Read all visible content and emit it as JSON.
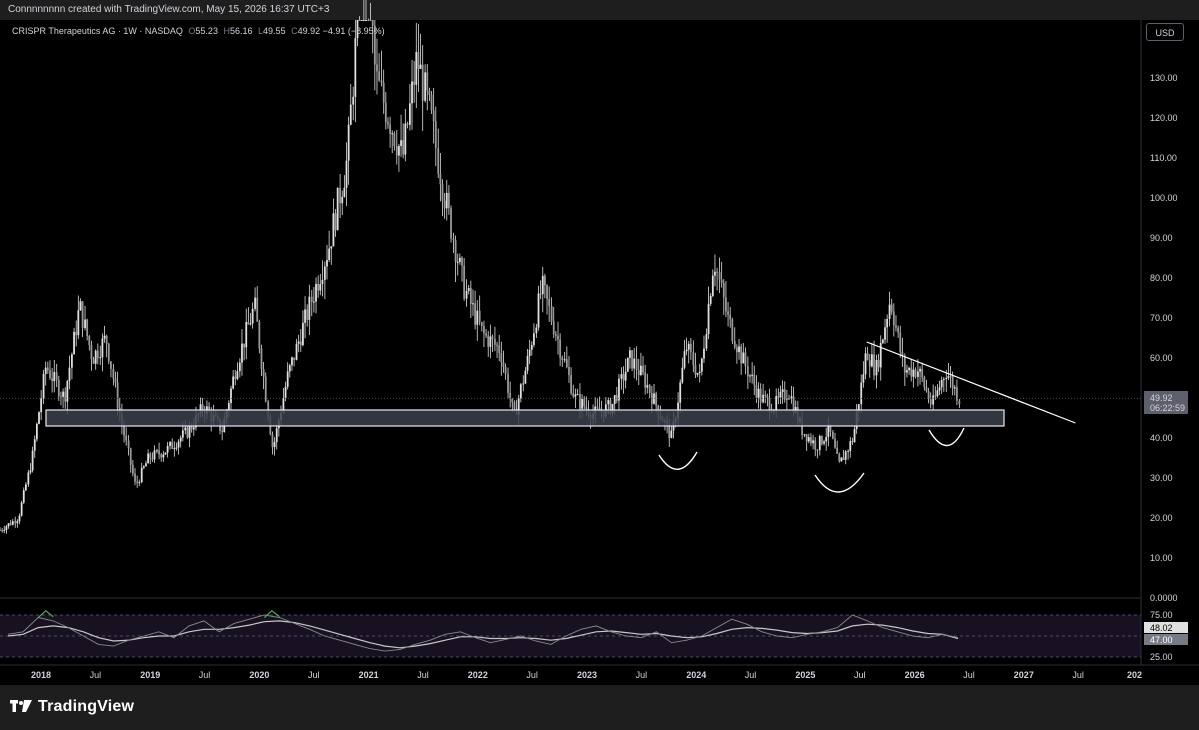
{
  "header": {
    "credit": "Connnnnnnn created with TradingView.com, May 15, 2026 16:37 UTC+3"
  },
  "legend": {
    "symbol": "CRISPR Therapeutics AG · 1W · NASDAQ",
    "open_label": "O",
    "open": "55.23",
    "high_label": "H",
    "high": "56.16",
    "low_label": "L",
    "low": "49.55",
    "close_label": "C",
    "close": "49.92",
    "change": "−4.91 (−8.95%)"
  },
  "currency_button": "USD",
  "price_axis": {
    "ticks": [
      "130.00",
      "120.00",
      "110.00",
      "100.00",
      "90.00",
      "80.00",
      "70.00",
      "60.00",
      "40.00",
      "30.00",
      "20.00",
      "10.00",
      "0.0000"
    ],
    "last_price": "49.92",
    "countdown": "06:22:59"
  },
  "rsi_axis": {
    "ticks": [
      "75.00",
      "25.00"
    ],
    "rsi_value": "48.02",
    "ma_value": "47.00"
  },
  "time_axis": {
    "labels": [
      "2018",
      "Jul",
      "2019",
      "Jul",
      "2020",
      "Jul",
      "2021",
      "Jul",
      "2022",
      "Jul",
      "2023",
      "Jul",
      "2024",
      "Jul",
      "2025",
      "Jul",
      "2026",
      "Jul",
      "2027",
      "Jul",
      "202"
    ]
  },
  "footer": {
    "brand": "TradingView"
  },
  "colors": {
    "background": "#000000",
    "candles": "#e0e0e0",
    "annotation": "#ffffff",
    "zone_fill": "#3b3f4a",
    "rsi_band": "#2a1f3d",
    "rsi_line": "#b0b0b0",
    "rsi_overbought": "#4caf50",
    "last_price_bg": "#5d606b"
  },
  "chart_data": [
    {
      "type": "candlestick",
      "title": "CRISPR Therapeutics AG · 1W · NASDAQ",
      "ylim": [
        0,
        140
      ],
      "x_range": [
        "2017-10",
        "2028-01"
      ],
      "points": [
        [
          "2017-10-01",
          17
        ],
        [
          "2017-12-01",
          20
        ],
        [
          "2018-01-15",
          35
        ],
        [
          "2018-03-01",
          58
        ],
        [
          "2018-05-01",
          50
        ],
        [
          "2018-06-20",
          73
        ],
        [
          "2018-08-01",
          60
        ],
        [
          "2018-09-15",
          65
        ],
        [
          "2018-11-01",
          45
        ],
        [
          "2018-12-20",
          28
        ],
        [
          "2019-02-01",
          35
        ],
        [
          "2019-04-01",
          37
        ],
        [
          "2019-06-15",
          42
        ],
        [
          "2019-08-01",
          48
        ],
        [
          "2019-10-01",
          42
        ],
        [
          "2019-11-15",
          58
        ],
        [
          "2020-01-15",
          73
        ],
        [
          "2020-03-15",
          37
        ],
        [
          "2020-05-01",
          55
        ],
        [
          "2020-07-01",
          70
        ],
        [
          "2020-09-15",
          88
        ],
        [
          "2020-11-15",
          110
        ],
        [
          "2021-01-10",
          170
        ],
        [
          "2021-02-15",
          130
        ],
        [
          "2021-04-01",
          120
        ],
        [
          "2021-05-15",
          110
        ],
        [
          "2021-07-01",
          135
        ],
        [
          "2021-08-15",
          120
        ],
        [
          "2021-10-01",
          100
        ],
        [
          "2021-12-01",
          78
        ],
        [
          "2022-02-01",
          66
        ],
        [
          "2022-04-01",
          62
        ],
        [
          "2022-05-15",
          45
        ],
        [
          "2022-07-01",
          60
        ],
        [
          "2022-08-15",
          78
        ],
        [
          "2022-10-01",
          66
        ],
        [
          "2022-12-01",
          50
        ],
        [
          "2023-02-01",
          46
        ],
        [
          "2023-04-01",
          48
        ],
        [
          "2023-06-01",
          60
        ],
        [
          "2023-07-15",
          55
        ],
        [
          "2023-09-01",
          47
        ],
        [
          "2023-10-15",
          40
        ],
        [
          "2023-12-01",
          63
        ],
        [
          "2024-01-15",
          55
        ],
        [
          "2024-03-01",
          85
        ],
        [
          "2024-04-15",
          70
        ],
        [
          "2024-06-01",
          60
        ],
        [
          "2024-08-01",
          50
        ],
        [
          "2024-09-15",
          48
        ],
        [
          "2024-11-01",
          52
        ],
        [
          "2024-12-15",
          42
        ],
        [
          "2025-02-01",
          38
        ],
        [
          "2025-03-15",
          42
        ],
        [
          "2025-04-15",
          33
        ],
        [
          "2025-06-01",
          40
        ],
        [
          "2025-07-15",
          62
        ],
        [
          "2025-08-15",
          57
        ],
        [
          "2025-10-01",
          75
        ],
        [
          "2025-11-15",
          57
        ],
        [
          "2026-01-01",
          57
        ],
        [
          "2026-02-15",
          48
        ],
        [
          "2026-04-01",
          57
        ],
        [
          "2026-05-15",
          49.92
        ]
      ],
      "close": 49.92,
      "annotations": {
        "support_zone": [
          43,
          47
        ],
        "trendline": [
          [
            "2025-07-15",
            64
          ],
          [
            "2026-11-15",
            43
          ]
        ],
        "arcs": [
          "2023-10",
          "2025-04",
          "2026-03"
        ]
      }
    },
    {
      "type": "line",
      "title": "RSI",
      "ylim": [
        25,
        75
      ],
      "series": [
        {
          "values": [
            52,
            55,
            72,
            68,
            60,
            50,
            40,
            38,
            45,
            50,
            55,
            48,
            62,
            68,
            55,
            65,
            70,
            75,
            72,
            65,
            58,
            50,
            45,
            40,
            35,
            32,
            34,
            40,
            45,
            52,
            55,
            48,
            42,
            46,
            50,
            44,
            40,
            50,
            58,
            62,
            55,
            50,
            48,
            55,
            42,
            45,
            50,
            60,
            70,
            64,
            55,
            50,
            48,
            52,
            55,
            60,
            75,
            68,
            60,
            55,
            50,
            48,
            52,
            48.02
          ]
        },
        {
          "values": [
            50,
            52,
            60,
            62,
            60,
            55,
            48,
            44,
            45,
            48,
            50,
            50,
            55,
            58,
            58,
            60,
            63,
            67,
            68,
            66,
            62,
            57,
            52,
            47,
            42,
            38,
            36,
            38,
            41,
            45,
            49,
            49,
            47,
            47,
            48,
            47,
            45,
            47,
            51,
            55,
            56,
            54,
            52,
            53,
            50,
            48,
            49,
            53,
            58,
            60,
            59,
            57,
            54,
            53,
            54,
            56,
            62,
            64,
            63,
            60,
            56,
            53,
            52,
            47.0
          ]
        }
      ],
      "levels": [
        75,
        25
      ],
      "last_values": {
        "rsi": 48.02,
        "ma": 47.0
      }
    }
  ]
}
